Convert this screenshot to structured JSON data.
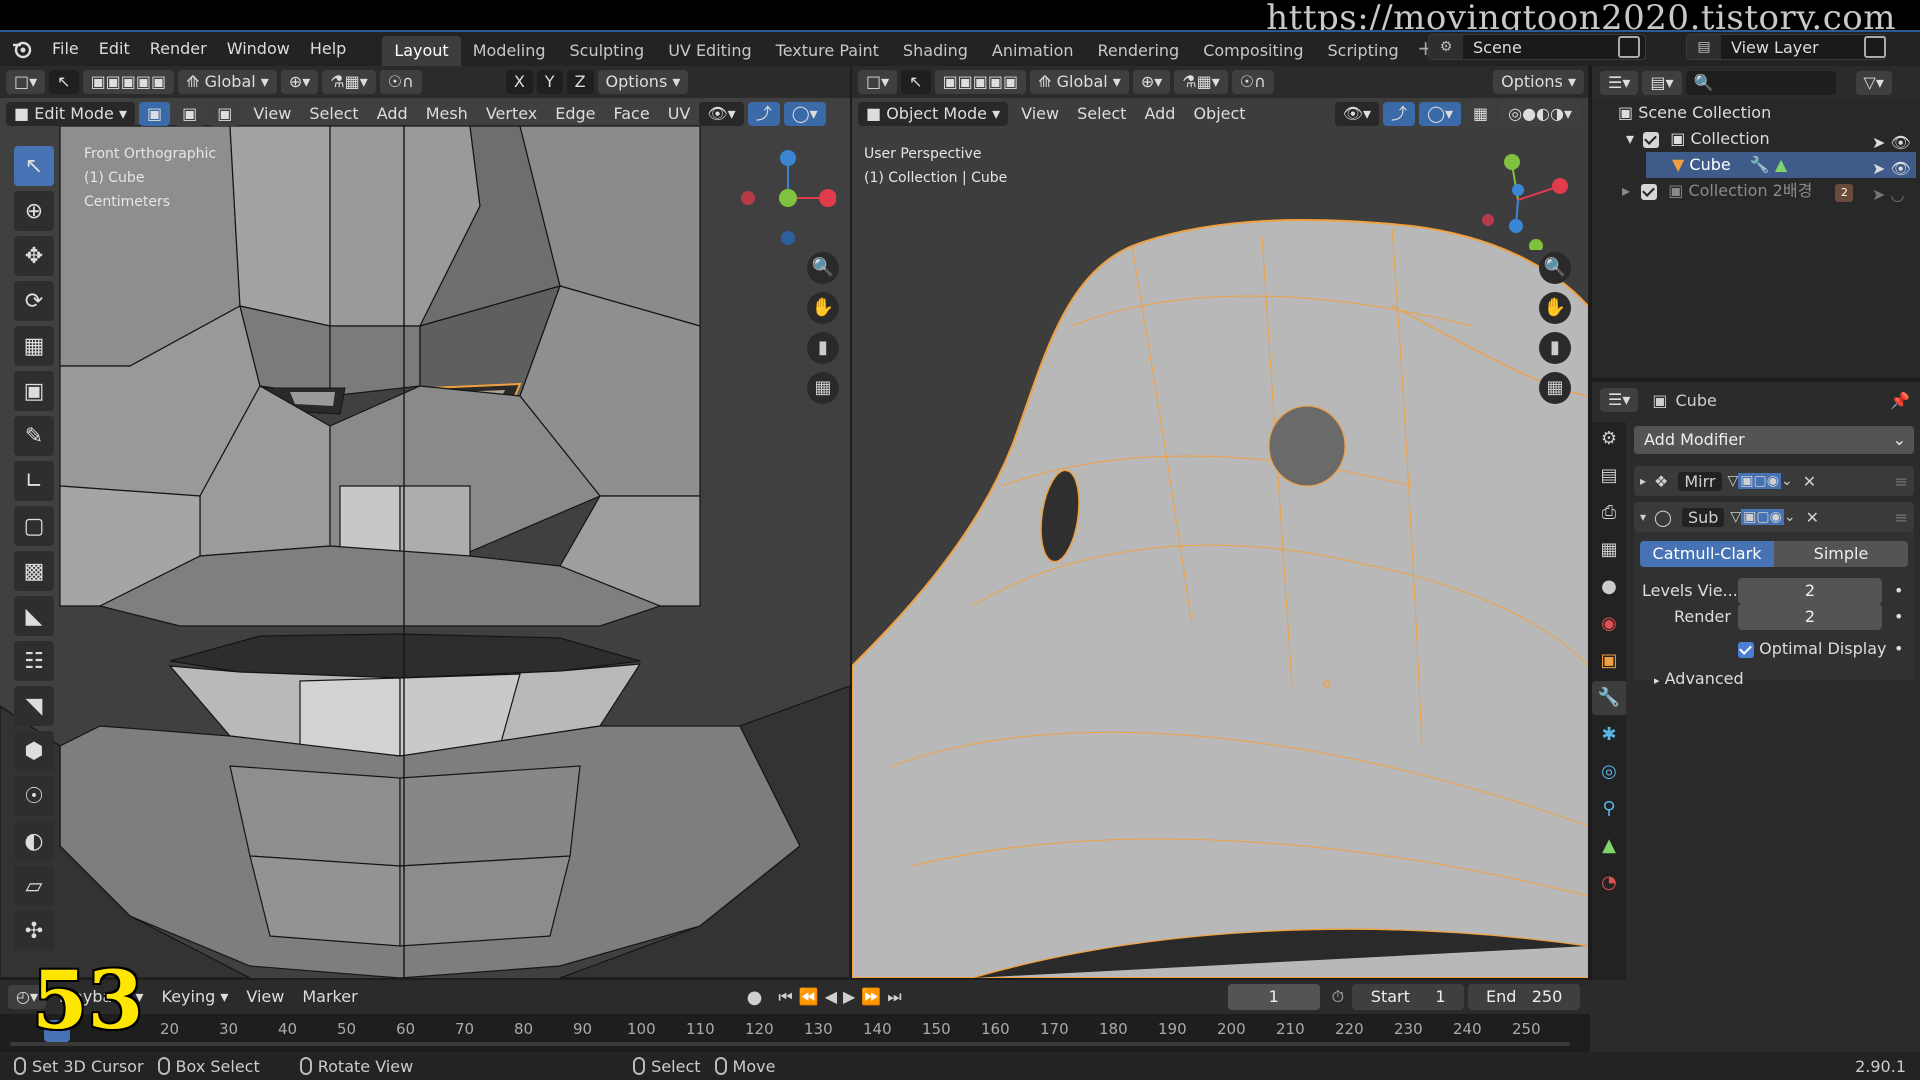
{
  "watermark": "https://movingtoon2020.tistory.com",
  "menubar": {
    "items": [
      "File",
      "Edit",
      "Render",
      "Window",
      "Help"
    ],
    "workspaces": [
      "Layout",
      "Modeling",
      "Sculpting",
      "UV Editing",
      "Texture Paint",
      "Shading",
      "Animation",
      "Rendering",
      "Compositing",
      "Scripting"
    ],
    "add": "+",
    "scene": "Scene",
    "view_layer": "View Layer"
  },
  "left_viewport": {
    "orientation": "Global",
    "x": "X",
    "y": "Y",
    "z": "Z",
    "options": "Options",
    "mode": "Edit Mode",
    "menus": [
      "View",
      "Select",
      "Add",
      "Mesh",
      "Vertex",
      "Edge",
      "Face",
      "UV"
    ],
    "overlay_lines": [
      "Front Orthographic",
      "(1) Cube",
      "Centimeters"
    ]
  },
  "right_viewport": {
    "orientation": "Global",
    "options": "Options",
    "mode": "Object Mode",
    "menus": [
      "View",
      "Select",
      "Add",
      "Object"
    ],
    "overlay_lines": [
      "User Perspective",
      "(1) Collection | Cube"
    ]
  },
  "outliner": {
    "scene_collection": "Scene Collection",
    "collection": "Collection",
    "cube": "Cube",
    "collection2": "Collection 2배경",
    "badge": "2"
  },
  "properties": {
    "object_name": "Cube",
    "add_modifier": "Add Modifier",
    "modifier1": "Mirr",
    "modifier2": "Sub",
    "catmull": "Catmull-Clark",
    "simple": "Simple",
    "levels_label": "Levels Vie...",
    "levels_value": "2",
    "render_label": "Render",
    "render_value": "2",
    "optimal_display": "Optimal Display",
    "advanced": "Advanced"
  },
  "timeline": {
    "playback": "Playback",
    "keying": "Keying",
    "view": "View",
    "marker": "Marker",
    "current_frame": "1",
    "start_label": "Start",
    "start_value": "1",
    "end_label": "End",
    "end_value": "250",
    "ticks": [
      "20",
      "30",
      "40",
      "50",
      "60",
      "70",
      "80",
      "90",
      "100",
      "110",
      "120",
      "130",
      "140",
      "150",
      "160",
      "170",
      "180",
      "190",
      "200",
      "210",
      "220",
      "230",
      "240",
      "250"
    ],
    "overlay_number": "53"
  },
  "statusbar": {
    "item1": "Set 3D Cursor",
    "item2": "Box Select",
    "item3": "Rotate View",
    "item4": "Select",
    "item5": "Move",
    "version": "2.90.1"
  },
  "colors": {
    "accent": "#4772b3",
    "selection": "#f0a040",
    "axis_x": "#e03c4b",
    "axis_y": "#7fc23d",
    "axis_z": "#3a86d4"
  }
}
